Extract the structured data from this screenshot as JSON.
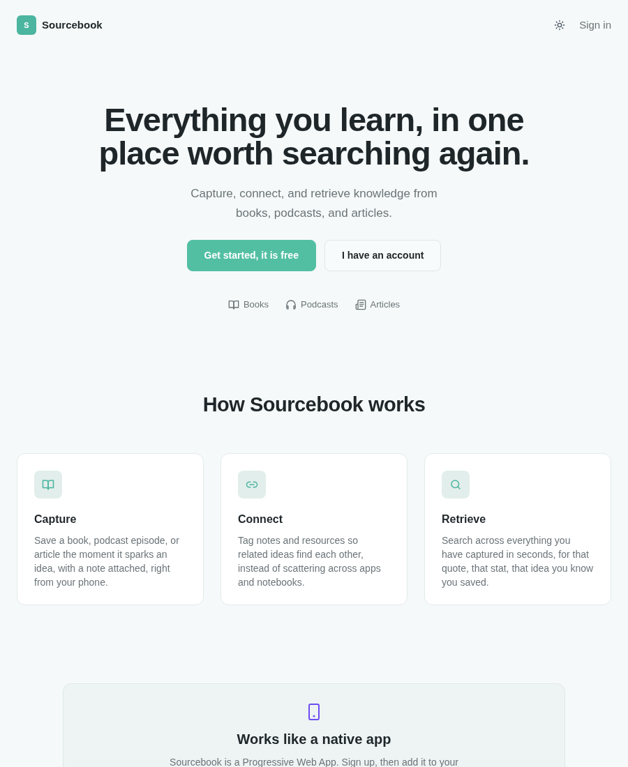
{
  "header": {
    "logo_mark": "S",
    "brand": "Sourcebook",
    "sign_in": "Sign in"
  },
  "hero": {
    "title": "Everything you learn, in one place worth searching again.",
    "subtitle": "Capture, connect, and retrieve knowledge from books, podcasts, and articles.",
    "buttons": [
      {
        "label": "Get started, it is free",
        "kind": "primary"
      },
      {
        "label": "I have an account",
        "kind": "secondary"
      }
    ],
    "sources": [
      {
        "label": "Books",
        "kind": "book"
      },
      {
        "label": "Podcasts",
        "kind": "headphones"
      },
      {
        "label": "Articles",
        "kind": "newspaper"
      }
    ]
  },
  "how": {
    "title": "How Sourcebook works",
    "cards": [
      {
        "kind": "book",
        "title": "Capture",
        "text": "Save a book, podcast episode, or article the moment it sparks an idea, with a note attached, right from your phone."
      },
      {
        "kind": "link",
        "title": "Connect",
        "text": "Tag notes and resources so related ideas find each other, instead of scattering across apps and notebooks."
      },
      {
        "kind": "search",
        "title": "Retrieve",
        "text": "Search across everything you have captured in seconds, for that quote, that stat, that idea you know you saved."
      }
    ]
  },
  "pwa": {
    "title": "Works like a native app",
    "text": "Sourcebook is a Progressive Web App. Sign up, then add it to your"
  }
}
